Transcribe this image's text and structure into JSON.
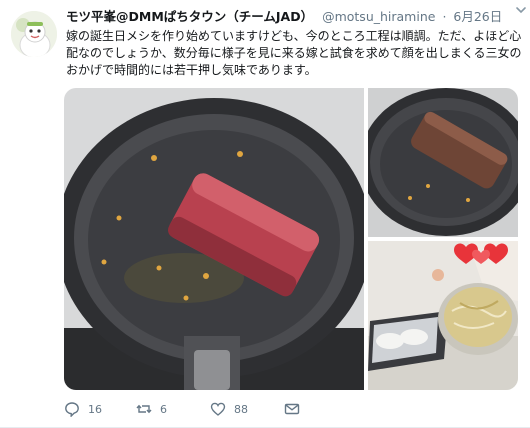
{
  "tweet": {
    "display_name": "モツ平峯@DMMぱちタウン（チームJAD）",
    "handle": "@motsu_hiramine",
    "separator": "·",
    "date": "6月26日",
    "text": "嫁の誕生日メシを作り始めていますけども、今のところ工程は順調。ただ、よほど心配なのでしょうか、数分毎に様子を見に来る嫁と試食を求めて顔を出しまくる三女のおかげで時間的には若干押し気味であります。"
  },
  "actions": {
    "replies": "16",
    "retweets": "6",
    "likes": "88"
  },
  "colors": {
    "text": "#14171a",
    "secondary": "#657786",
    "pan": "#3b3c3f",
    "meat_raw": "#b8414f",
    "meat_seared": "#6e4536"
  }
}
